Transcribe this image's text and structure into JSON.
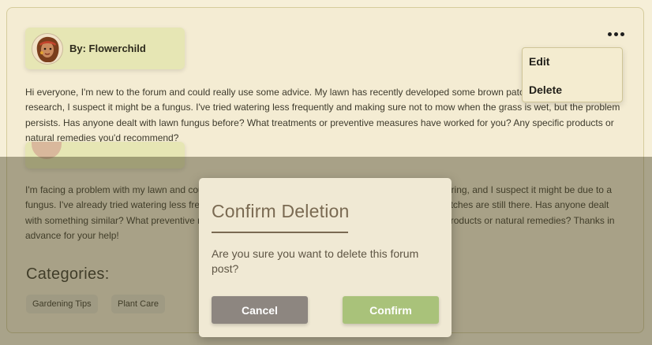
{
  "post": {
    "author_label": "By: Flowerchild",
    "body": "Hi everyone, I'm new to the forum and could really use some advice. My lawn has recently developed some brown patches, and after some research, I suspect it might be a fungus. I've tried watering less frequently and making sure not to mow when the grass is wet, but the problem persists. Has anyone dealt with lawn fungus before? What treatments or preventive measures have worked for you? Any specific products or natural remedies you'd recommend?"
  },
  "menu": {
    "edit_label": "Edit",
    "delete_label": "Delete"
  },
  "reply": {
    "body": "I'm facing a problem with my lawn and could really use your advice. I've noticed brown patches appearing, and I suspect it might be due to a fungus. I've already tried watering less frequently and avoid mowing when the grass is wet, but the patches are still there. Has anyone dealt with something similar? What preventive measures have you found effective? Are there any specific products or natural remedies? Thanks in advance for your help!"
  },
  "categories": {
    "title": "Categories:",
    "tags": [
      "Gardening Tips",
      "Plant Care"
    ]
  },
  "dialog": {
    "title": "Confirm Deletion",
    "message": "Are you sure you want to delete this forum post?",
    "cancel_label": "Cancel",
    "confirm_label": "Confirm"
  },
  "colors": {
    "card_background": "#f4ecd3",
    "author_chip": "#e6e6b4",
    "cancel_button": "#8d8680",
    "confirm_button": "#a9c27a",
    "dialog_title": "#7a6a52"
  }
}
